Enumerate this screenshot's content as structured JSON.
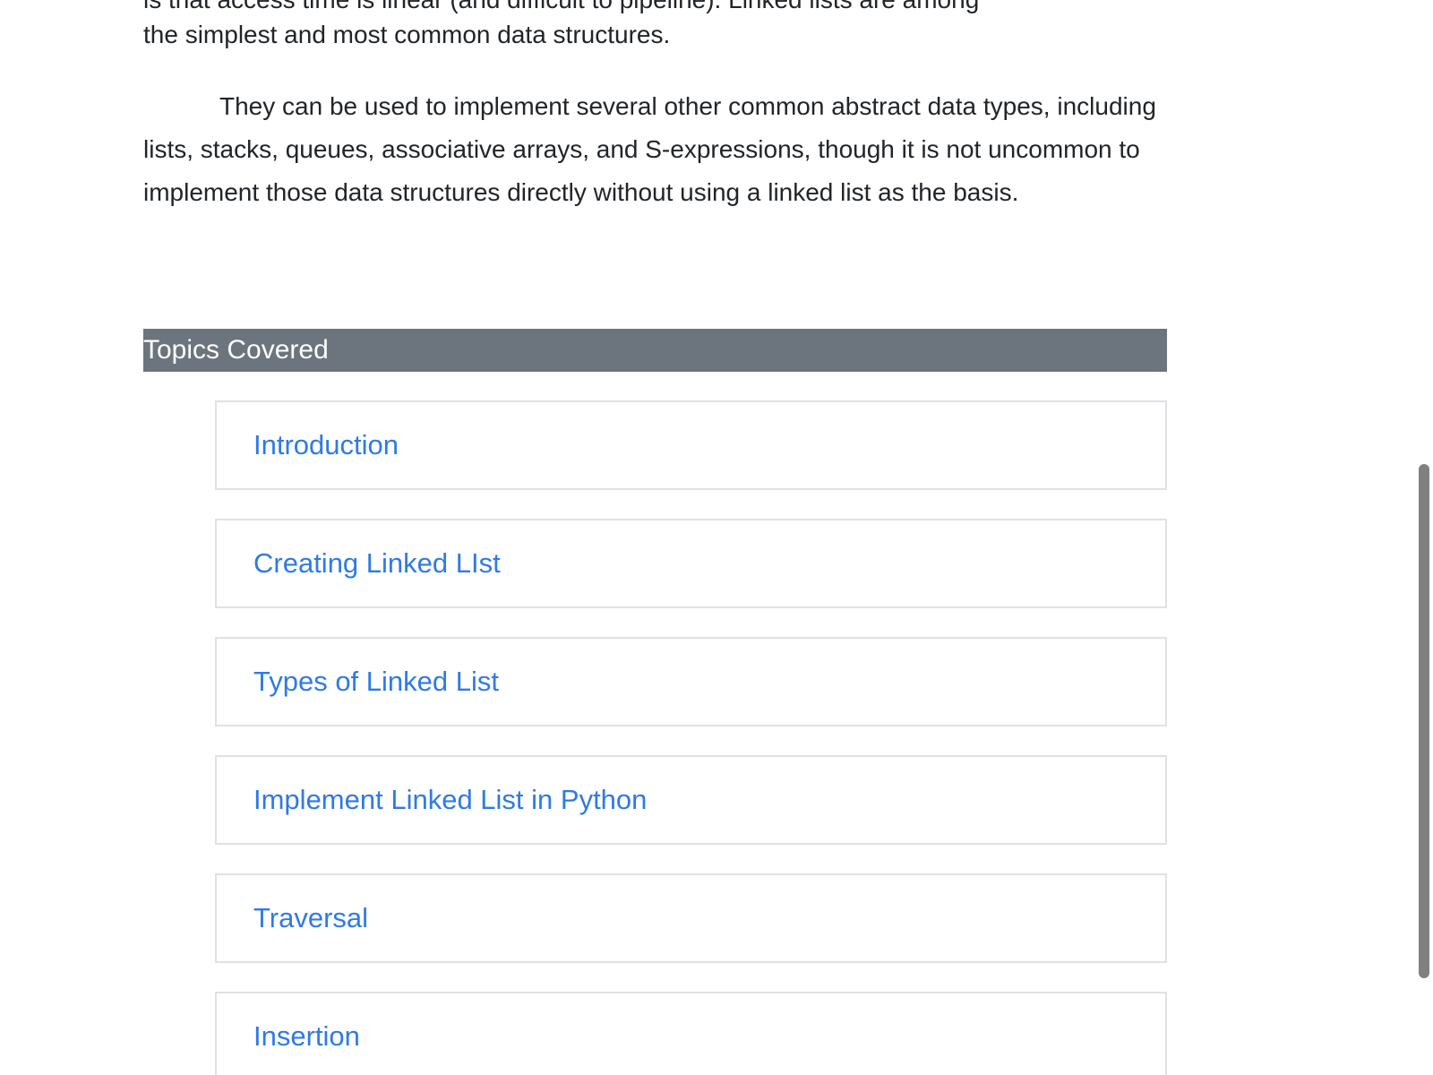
{
  "article": {
    "cut_line": "is that access time is linear (and difficult to pipeline). Linked lists are among",
    "paragraph_1_end": "the simplest and most common data structures.",
    "paragraph_2": "They can be used to implement several other common abstract data types, including lists, stacks, queues, associative arrays, and S-expressions, though it is not uncommon to implement those data structures directly without using a linked list as the basis."
  },
  "topics": {
    "header": "Topics Covered",
    "items": [
      {
        "label": "Introduction"
      },
      {
        "label": "Creating Linked LIst"
      },
      {
        "label": "Types of Linked List"
      },
      {
        "label": "Implement Linked List in Python"
      },
      {
        "label": "Traversal"
      },
      {
        "label": "Insertion"
      }
    ]
  },
  "scroll": {
    "position_fraction": 0.43
  },
  "colors": {
    "header_bg": "#6c757d",
    "link": "#2f7ae5",
    "card_border": "#dee2e6",
    "scrollbar_thumb": "#808080"
  }
}
